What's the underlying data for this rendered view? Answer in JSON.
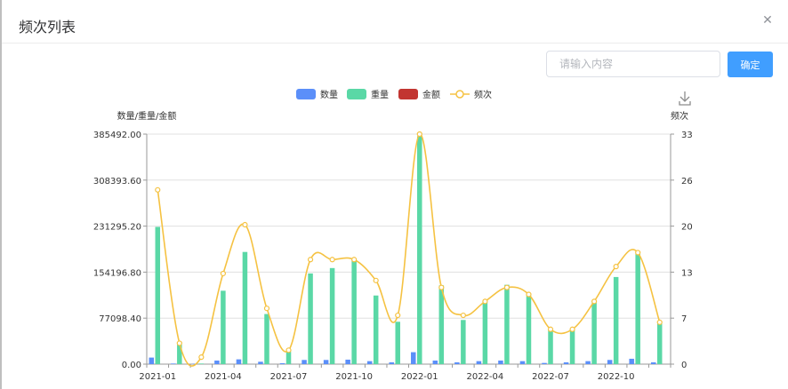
{
  "dialog": {
    "title": "频次列表",
    "close_icon": "close-icon"
  },
  "search": {
    "placeholder": "请输入内容",
    "value": ""
  },
  "confirm_label": "确定",
  "toolbox": {
    "download_icon": "download-icon"
  },
  "colors": {
    "count": "#5b8ff9",
    "weight": "#5ad8a6",
    "amount": "#c23531",
    "freq": "#f5c242",
    "primary": "#409eff"
  },
  "chart_data": {
    "type": "bar",
    "legend": [
      "数量",
      "重量",
      "金额",
      "频次"
    ],
    "legend_position": "top-center",
    "y_left_label": "数量/重量/金额",
    "y_right_label": "频次",
    "x_tick_labels": [
      "2021-01",
      "2021-04",
      "2021-07",
      "2021-10",
      "2022-01",
      "2022-04",
      "2022-07",
      "2022-10"
    ],
    "y_left_ticks": [
      "0.00",
      "77098.40",
      "154196.80",
      "231295.20",
      "308393.60",
      "385492.00"
    ],
    "y_right_ticks": [
      "0",
      "7",
      "13",
      "20",
      "26",
      "33"
    ],
    "y_left_range": [
      0,
      385492
    ],
    "y_right_range": [
      0,
      33
    ],
    "grid": true,
    "categories": [
      "2021-01",
      "2021-02",
      "2021-03",
      "2021-04",
      "2021-05",
      "2021-06",
      "2021-07",
      "2021-08",
      "2021-09",
      "2021-10",
      "2021-11",
      "2021-12",
      "2022-01",
      "2022-02",
      "2022-03",
      "2022-04",
      "2022-05",
      "2022-06",
      "2022-07",
      "2022-08",
      "2022-09",
      "2022-10",
      "2022-11",
      "2022-12"
    ],
    "series": [
      {
        "name": "数量",
        "type": "bar",
        "axis": "left",
        "values": [
          11000,
          1000,
          800,
          6000,
          8000,
          4000,
          1500,
          7000,
          7000,
          7500,
          5000,
          3000,
          20000,
          6000,
          3000,
          5000,
          6000,
          5000,
          2000,
          3000,
          5000,
          7000,
          9000,
          3000
        ]
      },
      {
        "name": "重量",
        "type": "bar",
        "axis": "left",
        "values": [
          230000,
          37000,
          1000,
          123000,
          188000,
          84000,
          21000,
          152000,
          161000,
          174000,
          115000,
          71000,
          382000,
          132000,
          74000,
          104000,
          133000,
          117000,
          58000,
          59000,
          103000,
          146000,
          186000,
          70000
        ]
      },
      {
        "name": "金额",
        "type": "bar",
        "axis": "left",
        "values": [
          0,
          0,
          0,
          0,
          0,
          0,
          0,
          0,
          0,
          0,
          0,
          0,
          0,
          0,
          0,
          0,
          0,
          0,
          0,
          0,
          0,
          0,
          0,
          0
        ]
      },
      {
        "name": "频次",
        "type": "line",
        "axis": "right",
        "smooth": true,
        "values": [
          25,
          3,
          1,
          13,
          20,
          8,
          2,
          15,
          15,
          15,
          12,
          7,
          33,
          11,
          7,
          9,
          11,
          10,
          5,
          5,
          9,
          14,
          16,
          6
        ]
      }
    ]
  }
}
